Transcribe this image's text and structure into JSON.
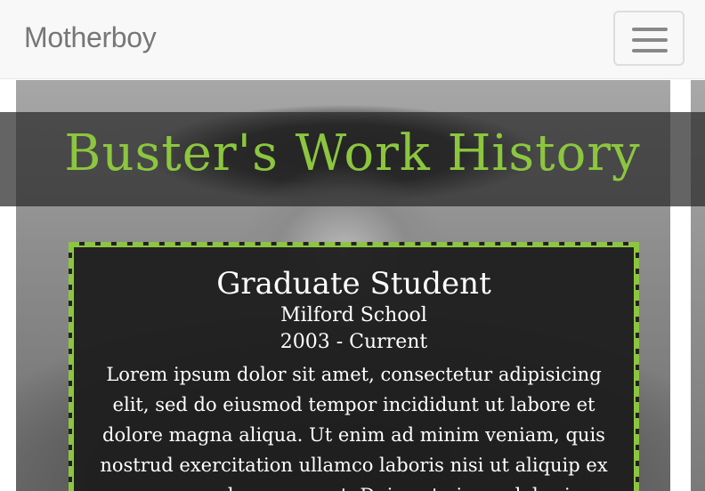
{
  "navbar": {
    "brand": "Motherboy",
    "menu_icon": "hamburger-icon"
  },
  "hero": {
    "title": "Buster's Work History",
    "accent_color": "#8cc63f"
  },
  "job": {
    "title": "Graduate Student",
    "organization": "Milford School",
    "dates": "2003 - Current",
    "description": "Lorem ipsum dolor sit amet, consectetur adipisicing elit, sed do eiusmod tempor incididunt ut labore et dolore magna aliqua. Ut enim ad minim veniam, quis nostrud exercitation ullamco laboris nisi ut aliquip ex ea commodo consequat. Duis aute irure dolor in"
  }
}
